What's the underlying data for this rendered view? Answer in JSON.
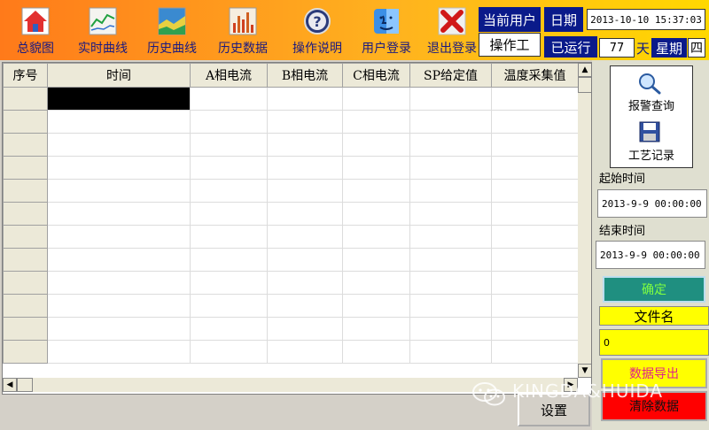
{
  "toolbar": {
    "buttons": [
      {
        "label": "总貌图",
        "icon": "home-icon"
      },
      {
        "label": "实时曲线",
        "icon": "realtime-chart-icon"
      },
      {
        "label": "历史曲线",
        "icon": "history-chart-icon"
      },
      {
        "label": "历史数据",
        "icon": "bar-data-icon"
      },
      {
        "label": "操作说明",
        "icon": "help-icon"
      },
      {
        "label": "用户登录",
        "icon": "user-login-icon"
      },
      {
        "label": "退出登录",
        "icon": "exit-x-icon"
      }
    ]
  },
  "status": {
    "current_user_label": "当前用户",
    "current_user_value": "操作工",
    "date_label": "日期",
    "date_value": "2013-10-10 15:37:03",
    "running_label": "已运行",
    "running_days": "77",
    "days_unit": "天",
    "weekday_label": "星期",
    "weekday_value": "四"
  },
  "grid": {
    "columns": [
      "序号",
      "时间",
      "A相电流",
      "B相电流",
      "C相电流",
      "SP给定值",
      "温度采集值"
    ],
    "row_count": 12
  },
  "panel": {
    "alarm_query_label": "报警查询",
    "process_record_label": "工艺记录",
    "start_time_label": "起始时间",
    "start_time_value": "2013-9-9 00:00:00",
    "end_time_label": "结束时间",
    "end_time_value": "2013-9-9 00:00:00",
    "confirm_label": "确定",
    "filename_label": "文件名",
    "filename_value": "0",
    "export_label": "数据导出",
    "clear_label": "清除数据",
    "settings_label": "设置"
  },
  "watermark": "KINGDA&HUIDA",
  "colors": {
    "toolbar_left": "#ff7a1a",
    "toolbar_right": "#ffd800",
    "navy": "#0a1a8a",
    "confirm_bg": "#1f8f80",
    "yellow": "#ffff00",
    "red": "#ff0000"
  }
}
